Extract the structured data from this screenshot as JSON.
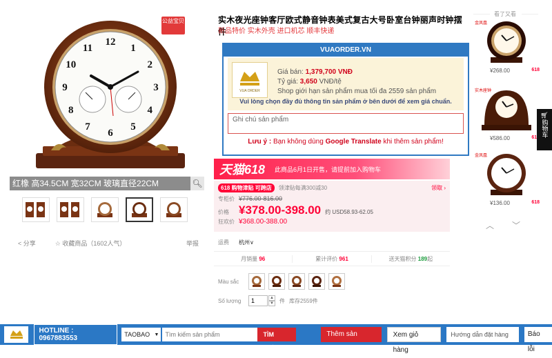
{
  "gallery": {
    "badge": "公益宝贝",
    "caption": "红橡  高34.5CM 宽32CM 玻璃直径22CM",
    "share": "分享",
    "favorite": "收藏商品（1602人气）",
    "report": "举报",
    "clock_numerals": [
      "12",
      "1",
      "2",
      "3",
      "4",
      "5",
      "6",
      "7",
      "8",
      "9",
      "10",
      "11"
    ]
  },
  "product": {
    "title": "实木夜光座钟客厅欧式静音钟表美式复古大号卧室台钟丽声时钟摆件",
    "subtitle": "新品特价 实木外壳 进口机芯 顺丰快递"
  },
  "vua": {
    "header": "VUAORDER.VN",
    "price_label": "Giá bán: ",
    "price_value": "1,379,700",
    "price_unit": " VNĐ",
    "rate_label": "Tỷ giá: ",
    "rate_value": "3,650",
    "rate_unit": " VNĐ/tệ",
    "limit": "Shop giới hạn sản phẩm mua tối đa 2559 sản phẩm",
    "notice": "Vui lòng chọn đầy đủ thông tin sản phẩm ở bên dưới để xem giá chuẩn.",
    "note_placeholder": "Ghi chú sản phẩm",
    "warn_prefix": "Lưu ý : ",
    "warn_mid": "Bạn không dùng ",
    "warn_brand": "Google Translate",
    "warn_suffix": " khi thêm sản phẩm!"
  },
  "tmall": {
    "logo": "天猫618",
    "msg": "此商品6月1日开售，请提前加入购物车",
    "promo_tag": "618 购物津贴 可跨店",
    "promo_text": "领津贴每满300减30",
    "promo_link": "领取",
    "label_old": "专柜价",
    "old_price": "¥776.00-816.00",
    "label_price": "价格",
    "price": "¥378.00-398.00",
    "usd": "约 USD58.93-62.05",
    "label_vip": "狂欢价",
    "vip_price": "¥368.00-388.00"
  },
  "shipping": {
    "label": "运费",
    "value": "杭州∨"
  },
  "stats": {
    "sales_label": "月销量 ",
    "sales": "96",
    "reviews_label": "累计评价 ",
    "reviews": "961",
    "points_label": "送天猫积分 ",
    "points": "189",
    "points_suffix": "起"
  },
  "options": {
    "color_label": "Màu sắc",
    "qty_label": "Số lượng",
    "qty_value": "1",
    "unit": "件",
    "stock": "库存2559件"
  },
  "recommend": {
    "title": "看了又看",
    "items": [
      {
        "price": "¥268.00",
        "tag": "618",
        "brand": "金凤凰"
      },
      {
        "price": "¥586.00",
        "tag": "618",
        "brand": "实木座钟"
      },
      {
        "price": "¥136.00",
        "tag": "618",
        "brand": "金凤凰"
      }
    ],
    "side_cart": "购物车"
  },
  "toolbar": {
    "hotline_label": "HOTLINE : ",
    "hotline_number": "0967883553",
    "source": "TAOBAO",
    "search_placeholder": "Tìm kiếm sản phẩm",
    "search_btn": "TÌM KIẾM",
    "add_btn": "Thêm sản phẩm",
    "view_cart": "Xem giỏ hàng",
    "guide_placeholder": "Hướng dẫn đặt hàng",
    "report_btn": "Báo lỗi"
  },
  "colors": {
    "accent_blue": "#2b78c5",
    "tmall_red": "#ff0036",
    "price_red": "#d0021b"
  }
}
